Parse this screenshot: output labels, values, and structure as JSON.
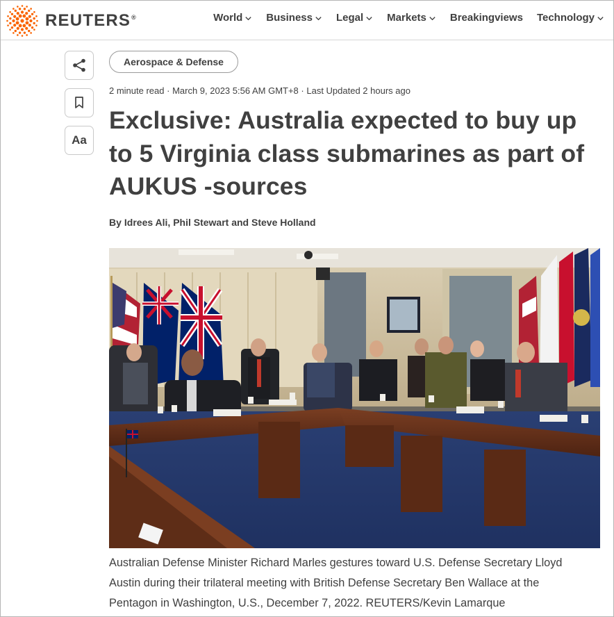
{
  "brand": {
    "logo_text": "REUTERS",
    "registered_mark": "®",
    "logo_color": "#fa6400",
    "text_color": "#404040"
  },
  "nav": {
    "items": [
      {
        "label": "World",
        "has_dropdown": true
      },
      {
        "label": "Business",
        "has_dropdown": true
      },
      {
        "label": "Legal",
        "has_dropdown": true
      },
      {
        "label": "Markets",
        "has_dropdown": true
      },
      {
        "label": "Breakingviews",
        "has_dropdown": false
      },
      {
        "label": "Technology",
        "has_dropdown": true
      }
    ]
  },
  "toolbar": {
    "share_icon": "share-icon",
    "bookmark_icon": "bookmark-icon",
    "text_size_label": "Aa"
  },
  "article": {
    "section_tag": "Aerospace & Defense",
    "read_time": "2 minute read",
    "published": "March 9, 2023 5:56 AM GMT+8",
    "last_updated": "Last Updated 2 hours ago",
    "separator": " · ",
    "headline_lines": [
      "Exclusive: Australia expected to buy up",
      "to 5 Virginia class submarines as part of",
      "AUKUS -sources"
    ],
    "byline_prefix": "By",
    "authors": "Idrees Ali, Phil Stewart and Steve Holland",
    "caption_lines": [
      "Australian Defense Minister Richard Marles gestures toward U.S. Defense Secretary Lloyd",
      "Austin during their trilateral meeting with British Defense Secretary Ben Wallace at the",
      "Pentagon in Washington, U.S., December 7, 2022. REUTERS/Kevin Lamarque"
    ]
  }
}
